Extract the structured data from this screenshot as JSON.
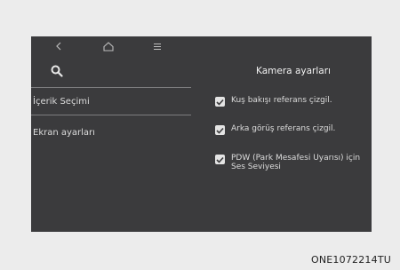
{
  "nav": {
    "back_icon": "chevron-left-icon",
    "home_icon": "home-icon",
    "menu_icon": "menu-icon",
    "search_icon": "search-icon"
  },
  "sidebar": {
    "items": [
      {
        "label": "İçerik Seçimi"
      },
      {
        "label": "Ekran ayarları"
      }
    ]
  },
  "panel": {
    "title": "Kamera ayarları",
    "options": [
      {
        "label": "Kuş bakışı referans çizgil.",
        "checked": true
      },
      {
        "label": "Arka görüş referans çizgil.",
        "checked": true
      },
      {
        "label": "PDW (Park Mesafesi Uyarısı) için Ses Seviyesi",
        "checked": true
      }
    ]
  },
  "caption": "ONE1072214TU",
  "colors": {
    "screen_bg": "#3b3b3d",
    "text": "#dcdcdc",
    "checkbox": "#e4e4e4",
    "page_bg": "#ececec"
  }
}
